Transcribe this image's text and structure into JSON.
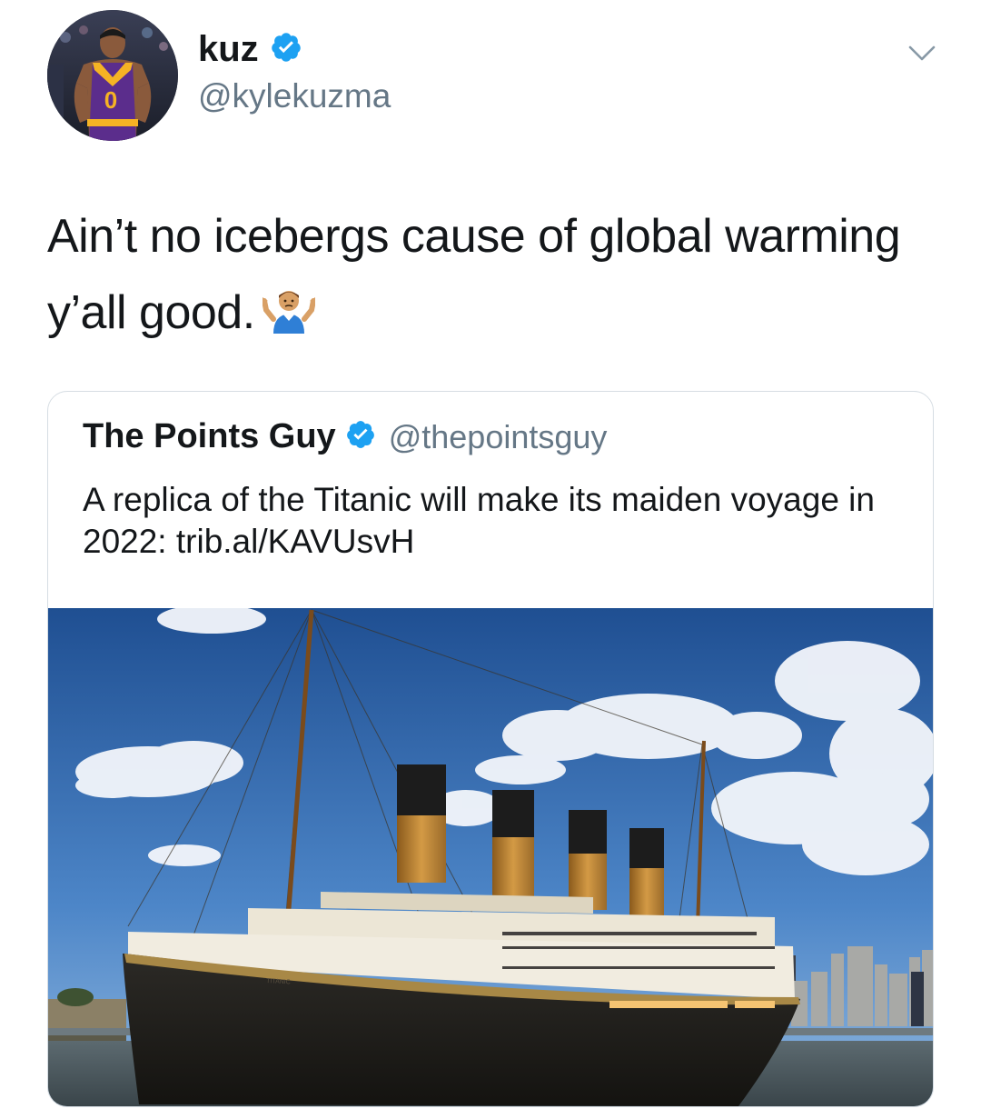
{
  "author": {
    "display_name": "kuz",
    "handle": "@kylekuzma",
    "verified": true,
    "avatar_jersey_number": "0"
  },
  "tweet": {
    "text": "Ain’t no icebergs cause of global warming y’all good.",
    "emoji": "person-shrugging"
  },
  "quoted_tweet": {
    "display_name": "The Points Guy",
    "handle": "@thepointsguy",
    "verified": true,
    "text": "A replica of the Titanic will make its maiden voyage in 2022: trib.al/KAVUsvH",
    "image_ship_name": "TITANIC"
  },
  "colors": {
    "verified_blue": "#1da1f2",
    "secondary_text": "#657786",
    "primary_text": "#14171a",
    "card_border": "#d6dde3"
  },
  "icons": [
    "verified-badge-icon",
    "chevron-down-icon",
    "shrug-emoji-icon"
  ]
}
